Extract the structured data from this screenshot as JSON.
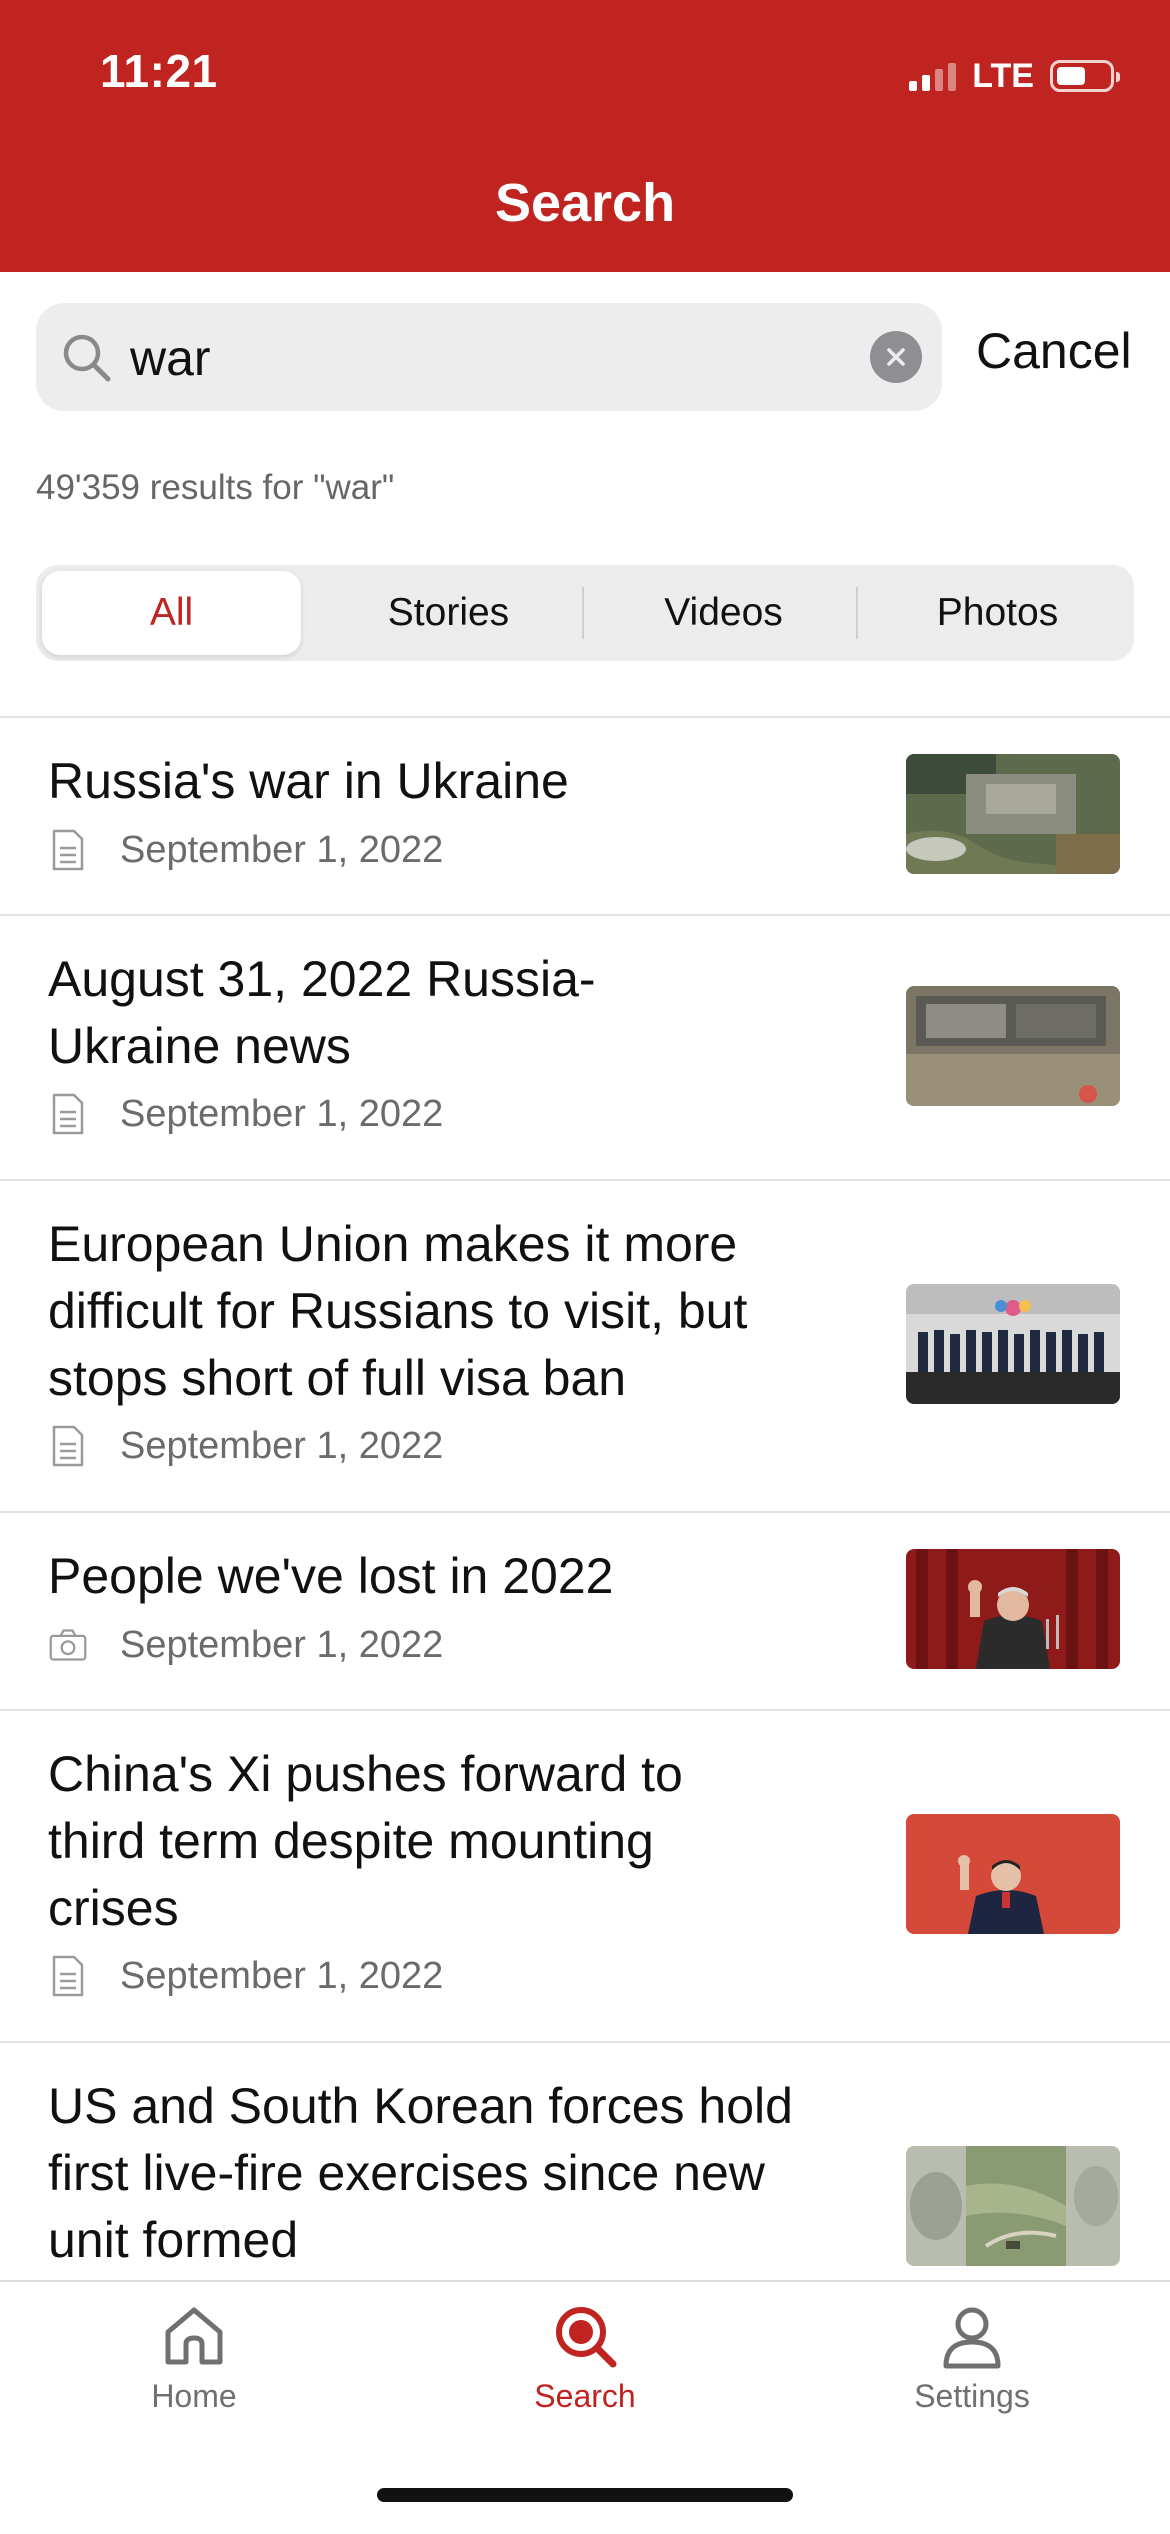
{
  "status_bar": {
    "time": "11:21",
    "network": "LTE"
  },
  "header": {
    "title": "Search"
  },
  "search": {
    "query": "war",
    "cancel_label": "Cancel"
  },
  "results_count": "49'359 results for \"war\"",
  "tabs": [
    {
      "label": "All",
      "active": true
    },
    {
      "label": "Stories",
      "active": false
    },
    {
      "label": "Videos",
      "active": false
    },
    {
      "label": "Photos",
      "active": false
    }
  ],
  "results": [
    {
      "title": "Russia's war in Ukraine",
      "date": "September 1, 2022",
      "type_icon": "document-icon"
    },
    {
      "title": "August 31, 2022 Russia-Ukraine news",
      "date": "September 1, 2022",
      "type_icon": "document-icon"
    },
    {
      "title": "European Union makes it more difficult for Russians to visit, but stops short of full visa ban",
      "date": "September 1, 2022",
      "type_icon": "document-icon"
    },
    {
      "title": "People we've lost in 2022",
      "date": "September 1, 2022",
      "type_icon": "camera-icon"
    },
    {
      "title": "China's Xi pushes forward to third term despite mounting crises",
      "date": "September 1, 2022",
      "type_icon": "document-icon"
    },
    {
      "title": "US and South Korean forces hold first live-fire exercises since new unit formed",
      "date": "",
      "type_icon": "video-icon"
    }
  ],
  "nav": {
    "home": "Home",
    "search": "Search",
    "settings": "Settings"
  },
  "colors": {
    "brand": "#bf2420",
    "text_secondary": "#6b6b6b"
  }
}
